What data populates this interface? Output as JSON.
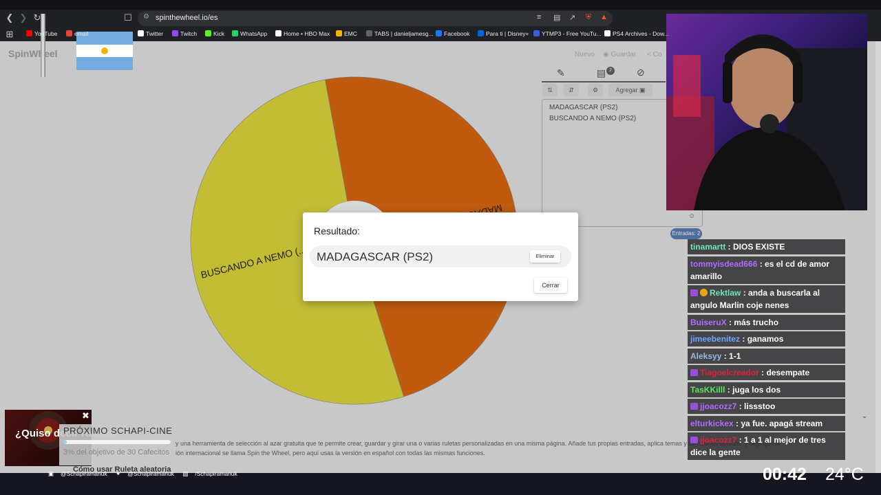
{
  "browser": {
    "url": "spinthewheel.io/es",
    "bookmarks": [
      {
        "label": "YouTube",
        "color": "#ff0000"
      },
      {
        "label": "email",
        "color": "#ea4335"
      },
      {
        "label": "Twitter",
        "color": "#ffffff"
      },
      {
        "label": "Twitch",
        "color": "#9146ff"
      },
      {
        "label": "Kick",
        "color": "#53fc18"
      },
      {
        "label": "WhatsApp",
        "color": "#25d366"
      },
      {
        "label": "Home • HBO Max",
        "color": "#ffffff"
      },
      {
        "label": "EMC",
        "color": "#f4b400"
      },
      {
        "label": "TABS | danieljamesg...",
        "color": "#5f6368"
      },
      {
        "label": "Facebook",
        "color": "#1877f2"
      },
      {
        "label": "Para ti | Disney+",
        "color": "#0063e5"
      },
      {
        "label": "YTMP3 - Free YouTu...",
        "color": "#3b5bdb"
      },
      {
        "label": "PS4 Archives - Dow...",
        "color": "#ffffff"
      }
    ]
  },
  "app": {
    "logo": "SpinWheel",
    "nav": {
      "new": "Nuevo",
      "save": "Guardar",
      "share": "Co"
    },
    "wheel": {
      "segments": [
        {
          "label": "BUSCANDO A NEMO (...",
          "color": "#c3bd35",
          "fraction": 0.52
        },
        {
          "label": "MADAGASCAR (PS2)",
          "color": "#bf5a0e",
          "fraction": 0.48
        }
      ]
    },
    "panel": {
      "add_label": "Agregar",
      "entries": [
        "MADAGASCAR (PS2)",
        "BUSCANDO A NEMO (PS2)"
      ],
      "count_label": "Entradas: 2",
      "notes_badge": "2"
    },
    "dialog": {
      "title": "Resultado:",
      "result": "MADAGASCAR (PS2)",
      "delete_label": "Eliminar",
      "close_label": "Cerrar"
    },
    "description": {
      "line1": "y una herramienta de selección al azar gratuita que te permite crear, guardar y girar una o varias ruletas personalizadas en una misma página. Añade tus propias entradas, aplica temas y cambia los sonidos, y deja que la",
      "line2": "ión internacional se llama Spin the Wheel, pero aquí usas la versión en español con todas las mismas funciones.",
      "heading": "Cómo usar Ruleta aleatoria"
    }
  },
  "stream": {
    "chat": [
      {
        "user": "tinamartt",
        "color": "#6ee7b7",
        "text": ": DIOS EXISTE",
        "badge": ""
      },
      {
        "user": "tommyisdead666",
        "color": "#b36bff",
        "text": ": es el cd de amor amarillo",
        "badge": ""
      },
      {
        "user": "Rektlaw",
        "color": "#6ee7b7",
        "text": ": anda a buscarla al angulo Marlin coje nenes",
        "badge": "sub2"
      },
      {
        "user": "BuiseruX",
        "color": "#b36bff",
        "text": ": más trucho",
        "badge": ""
      },
      {
        "user": "jimeebenitez",
        "color": "#6aa8ff",
        "text": ": ganamos",
        "badge": ""
      },
      {
        "user": "Aleksyy",
        "color": "#9ab8e8",
        "text": ": 1-1",
        "badge": ""
      },
      {
        "user": "Tiagoelcreador",
        "color": "#e0213a",
        "text": ": desempate",
        "badge": "sub"
      },
      {
        "user": "TasKKilll",
        "color": "#58e858",
        "text": ": juga los dos",
        "badge": ""
      },
      {
        "user": "jjoacozz7",
        "color": "#b36bff",
        "text": ": lissstoo",
        "badge": "sub"
      },
      {
        "user": "elturkickex",
        "color": "#b36bff",
        "text": ": ya fue. apagá stream",
        "badge": ""
      },
      {
        "user": "jjoacozz7",
        "color": "#e0213a",
        "text": ": 1 a 1 al mejor de tres dice la gente",
        "badge": "sub"
      }
    ],
    "goal": {
      "title": "PRÓXIMO SCHAPI-CINE",
      "text": "3% del objetivo de 30 Cafecitos",
      "progress": 0.03
    },
    "roulette_text": "¿Quiso decir Ruleta?",
    "socials": [
      "@Schapiramanuk",
      "@Schapiramanuk",
      "/Schapiramanuk"
    ],
    "clock": "00:42",
    "temp": "24°C"
  }
}
